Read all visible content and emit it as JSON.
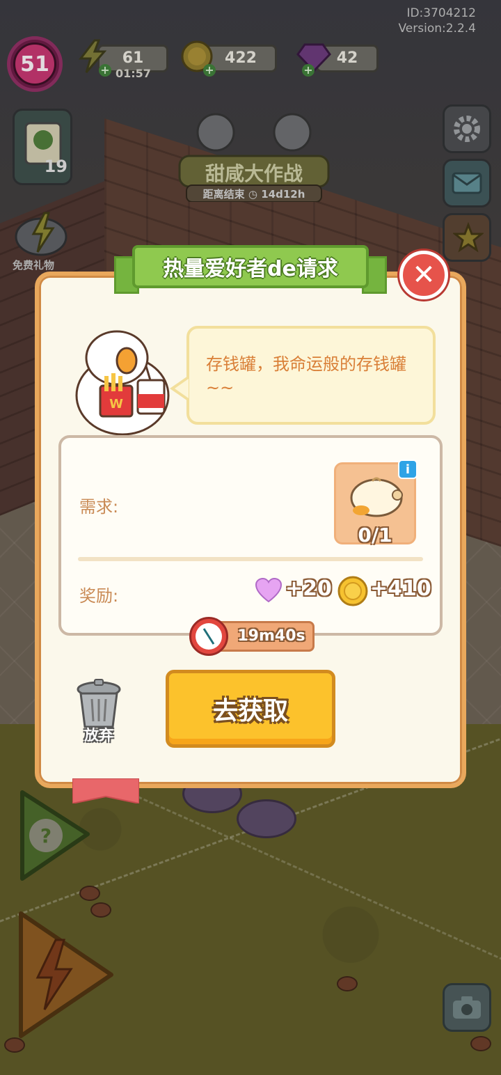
{
  "hud": {
    "player_id": "ID:3704212",
    "version": "Version:2.2.4",
    "level": "51",
    "energy": "61",
    "energy_timer": "01:57",
    "coins": "422",
    "gems": "42",
    "quest_count": "19"
  },
  "event_banner": {
    "title": "甜咸大作战",
    "subtitle": "距离结束",
    "countdown": "14d12h"
  },
  "side": {
    "free_gift_label": "免费礼物"
  },
  "dialog": {
    "title": "热量爱好者de请求",
    "speech": "存钱罐，我命运般的存钱罐~~",
    "requirement_label": "需求:",
    "requirement_count": "0/1",
    "reward_label": "奖励:",
    "reward_hearts": "+20",
    "reward_coins": "+410",
    "timer": "19m40s",
    "abandon_label": "放弃",
    "go_button": "去获取"
  },
  "colors": {
    "dialog_bg": "#fbf8eb",
    "dialog_border": "#e9a85c",
    "title_green": "#8fc94f",
    "close_red": "#e6534b",
    "go_yellow": "#fcc22c",
    "text_orange": "#d97f37"
  },
  "icons": [
    "lightning-icon",
    "coin-icon",
    "gem-icon",
    "plus-icon",
    "close-icon",
    "clock-icon",
    "heart-icon",
    "trash-icon",
    "question-icon",
    "camera-icon",
    "settings-icon",
    "mail-icon",
    "info-icon"
  ]
}
